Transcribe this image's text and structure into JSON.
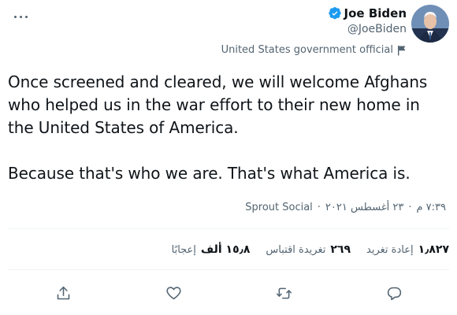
{
  "author": {
    "name": "Joe Biden",
    "handle": "@JoeBiden",
    "label": "United States government official"
  },
  "tweet": {
    "text": "Once screened and cleared, we will welcome Afghans\nwho helped us in the war effort to their new home in\nthe United States of America.\n\nBecause that's who we are. That's what America is."
  },
  "meta": {
    "time": "٧:٣٩ م",
    "date": "٢٣ أغسطس ٢٠٢١",
    "separator": "·",
    "source": "Sprout Social"
  },
  "stats": [
    {
      "count": "١٫٨٢٧",
      "label": "إعادة تغريد"
    },
    {
      "count": "٢٦٩",
      "label": "تغريدة اقتباس"
    },
    {
      "count": "١٥٫٨ ألف",
      "label": "إعجابًا"
    }
  ],
  "colors": {
    "text": "#0f1419",
    "secondary": "#536471",
    "verified": "#1d9bf0",
    "divider": "#eff3f4"
  },
  "icons": {
    "more": "more-icon",
    "verified": "verified-badge-icon",
    "flag": "flag-icon",
    "share": "share-icon",
    "like": "heart-icon",
    "retweet": "retweet-icon",
    "reply": "reply-icon"
  }
}
